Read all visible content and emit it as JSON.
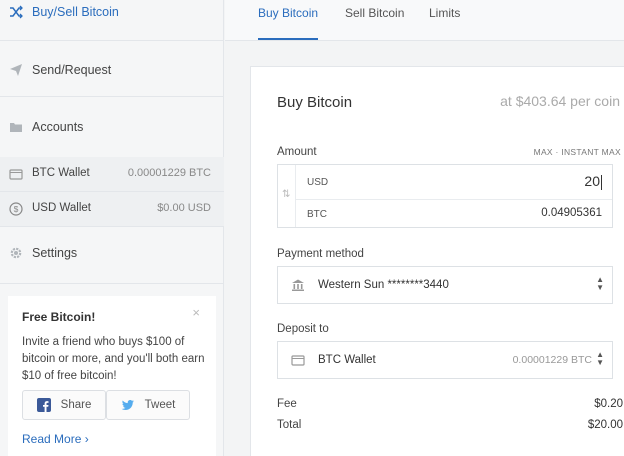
{
  "sidebar": {
    "nav": [
      {
        "label": "Buy/Sell Bitcoin",
        "icon": "shuffle-icon",
        "active": true
      },
      {
        "label": "Send/Request",
        "icon": "paper-plane-icon"
      },
      {
        "label": "Accounts",
        "icon": "folder-icon"
      },
      {
        "label": "Settings",
        "icon": "gear-icon"
      }
    ],
    "wallets": [
      {
        "name": "BTC Wallet",
        "balance": "0.00001229 BTC",
        "icon": "wallet-icon"
      },
      {
        "name": "USD Wallet",
        "balance": "$0.00 USD",
        "icon": "dollar-circle-icon"
      }
    ],
    "promo": {
      "title": "Free Bitcoin!",
      "close": "×",
      "text": "Invite a friend who buys $100 of bitcoin or more, and you'll both earn $10 of free bitcoin!",
      "share_label": "Share",
      "tweet_label": "Tweet",
      "read_more": "Read More ›"
    }
  },
  "tabs": [
    {
      "label": "Buy Bitcoin",
      "active": true
    },
    {
      "label": "Sell Bitcoin"
    },
    {
      "label": "Limits"
    }
  ],
  "form": {
    "title": "Buy Bitcoin",
    "price": "at $403.64 per coin",
    "amount_label": "Amount",
    "max_links": "MAX · INSTANT MAX",
    "swap_icon": "⇅",
    "usd_label": "USD",
    "usd_value": "20",
    "btc_label": "BTC",
    "btc_value": "0.04905361",
    "payment_label": "Payment method",
    "payment_value": "Western Sun ********3440",
    "deposit_label": "Deposit to",
    "deposit_value": "BTC Wallet",
    "deposit_balance": "0.00001229 BTC",
    "fee_label": "Fee",
    "fee_value": "$0.20",
    "total_label": "Total",
    "total_value": "$20.00"
  },
  "colors": {
    "accent": "#2b6dbd",
    "facebook": "#3b5998",
    "twitter": "#55acee"
  }
}
